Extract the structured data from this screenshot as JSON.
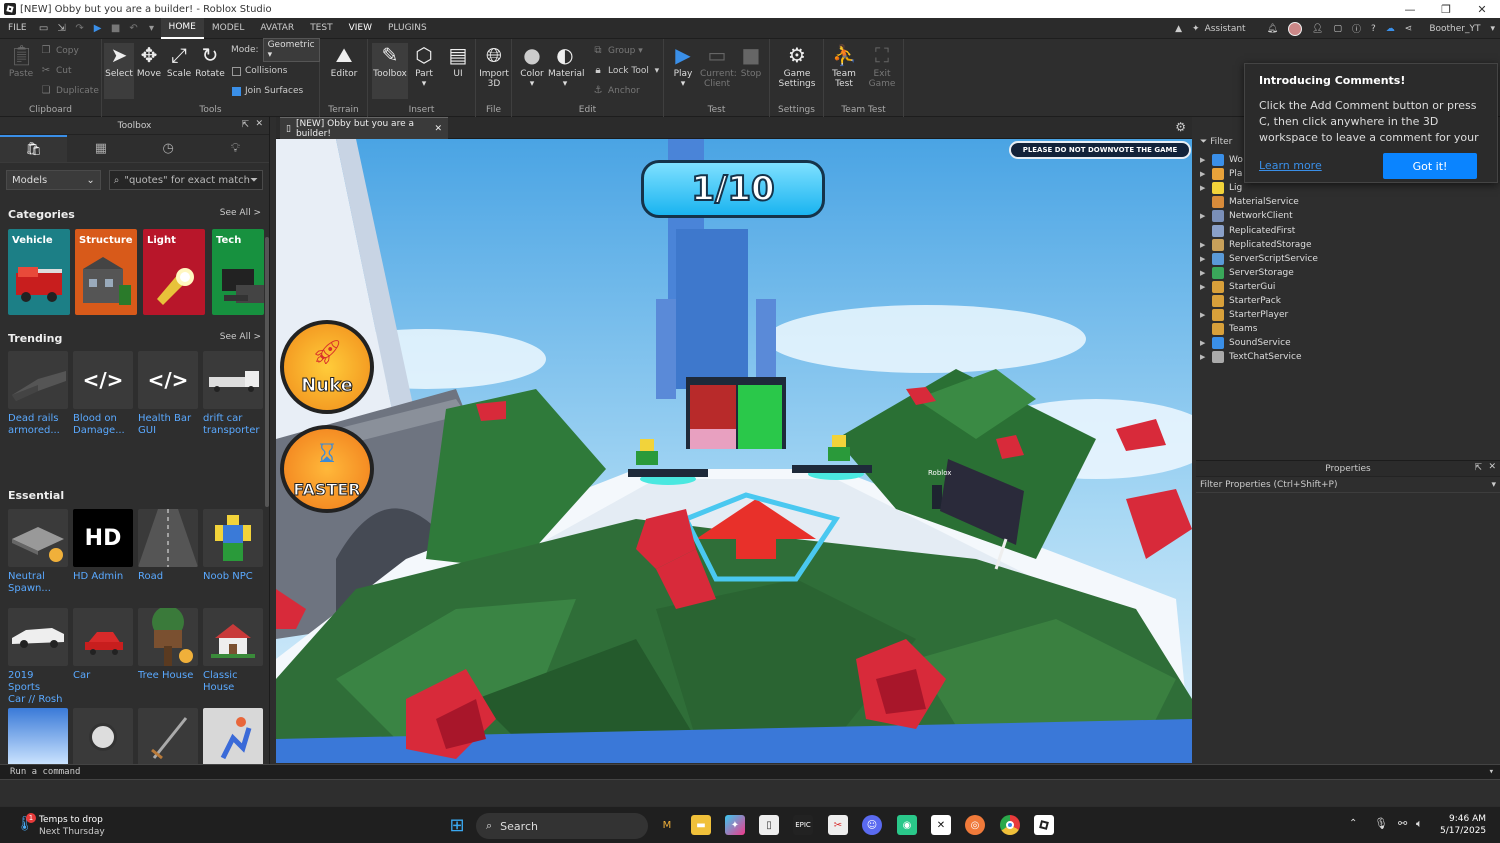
{
  "window": {
    "title": "[NEW] Obby but you are a builder! - Roblox Studio"
  },
  "menubar": {
    "items": [
      "FILE",
      "HOME",
      "MODEL",
      "AVATAR",
      "TEST",
      "VIEW",
      "PLUGINS"
    ],
    "active": "HOME",
    "assistant": "Assistant",
    "username": "Boother_YT"
  },
  "ribbon": {
    "clipboard": {
      "paste": "Paste",
      "copy": "Copy",
      "cut": "Cut",
      "duplicate": "Duplicate",
      "label": "Clipboard"
    },
    "tools": {
      "select": "Select",
      "move": "Move",
      "scale": "Scale",
      "rotate": "Rotate",
      "mode_label": "Mode:",
      "mode_value": "Geometric",
      "collisions": "Collisions",
      "join_surfaces": "Join Surfaces",
      "label": "Tools"
    },
    "terrain": {
      "editor": "Editor",
      "label": "Terrain"
    },
    "insert": {
      "toolbox": "Toolbox",
      "part": "Part",
      "ui": "UI",
      "label": "Insert"
    },
    "file": {
      "import1": "Import",
      "import2": "3D",
      "label": "File"
    },
    "edit": {
      "color": "Color",
      "material": "Material",
      "group": "Group",
      "lock_tool": "Lock Tool",
      "anchor": "Anchor",
      "label": "Edit"
    },
    "test": {
      "play": "Play",
      "current1": "Current:",
      "current2": "Client",
      "stop": "Stop",
      "label": "Test"
    },
    "settings": {
      "game1": "Game",
      "game2": "Settings",
      "label": "Settings"
    },
    "teamtest": {
      "team1": "Team",
      "team2": "Test",
      "exit1": "Exit",
      "exit2": "Game",
      "label": "Team Test"
    }
  },
  "toolbox": {
    "title": "Toolbox",
    "category_select": "Models",
    "search_placeholder": "\"quotes\" for exact match",
    "categories_title": "Categories",
    "trending_title": "Trending",
    "essential_title": "Essential",
    "see_all": "See All >",
    "categories": [
      {
        "name": "Vehicle",
        "color": "#1c7f86"
      },
      {
        "name": "Structure",
        "color": "#d85a1a"
      },
      {
        "name": "Light",
        "color": "#b8162a"
      },
      {
        "name": "Tech",
        "color": "#17913f"
      }
    ],
    "trending": [
      {
        "l1": "Dead rails",
        "l2": "armored..."
      },
      {
        "l1": "Blood on",
        "l2": "Damage..."
      },
      {
        "l1": "Health Bar",
        "l2": "GUI"
      },
      {
        "l1": "drift car",
        "l2": "transporter"
      }
    ],
    "essential_row1": [
      {
        "l1": "Neutral",
        "l2": "Spawn..."
      },
      {
        "l1": "HD Admin",
        "l2": ""
      },
      {
        "l1": "Road",
        "l2": ""
      },
      {
        "l1": "Noob NPC",
        "l2": ""
      }
    ],
    "essential_row2": [
      {
        "l1": "2019 Sports",
        "l2": "Car // Rosh"
      },
      {
        "l1": "Car",
        "l2": ""
      },
      {
        "l1": "Tree House",
        "l2": ""
      },
      {
        "l1": "Classic",
        "l2": "House"
      }
    ],
    "hd_text": "HD"
  },
  "document": {
    "tab": "[NEW] Obby but you are a builder!"
  },
  "viewport": {
    "progress": "1/10",
    "banner": "PLEASE DO NOT DOWNVOTE THE GAME",
    "nuke": "Nuke",
    "faster": "FASTER",
    "roblox_label": "Roblox"
  },
  "explorer": {
    "filter": "Filter",
    "items": [
      {
        "name": "Wo",
        "icon": "#3a8fe8",
        "arrow": true
      },
      {
        "name": "Pla",
        "icon": "#e8a23a",
        "arrow": true
      },
      {
        "name": "Lig",
        "icon": "#f2d33a",
        "arrow": true
      },
      {
        "name": "MaterialService",
        "icon": "#d88b3a",
        "arrow": false
      },
      {
        "name": "NetworkClient",
        "icon": "#7a8fb8",
        "arrow": true
      },
      {
        "name": "ReplicatedFirst",
        "icon": "#8aa0c8",
        "arrow": false
      },
      {
        "name": "ReplicatedStorage",
        "icon": "#c8a05a",
        "arrow": true
      },
      {
        "name": "ServerScriptService",
        "icon": "#5a9ad8",
        "arrow": true
      },
      {
        "name": "ServerStorage",
        "icon": "#3aa85a",
        "arrow": true
      },
      {
        "name": "StarterGui",
        "icon": "#d8a03a",
        "arrow": true
      },
      {
        "name": "StarterPack",
        "icon": "#d8a03a",
        "arrow": false
      },
      {
        "name": "StarterPlayer",
        "icon": "#d8a03a",
        "arrow": true
      },
      {
        "name": "Teams",
        "icon": "#d8a03a",
        "arrow": false
      },
      {
        "name": "SoundService",
        "icon": "#3a8fe8",
        "arrow": true
      },
      {
        "name": "TextChatService",
        "icon": "#aaaaaa",
        "arrow": true
      }
    ]
  },
  "popup": {
    "title": "Introducing Comments!",
    "body": "Click the Add Comment button or press C, then click anywhere in the 3D workspace to leave a comment for your",
    "learn_more": "Learn more",
    "got_it": "Got it!"
  },
  "properties": {
    "title": "Properties",
    "filter": "Filter Properties (Ctrl+Shift+P)"
  },
  "command": {
    "placeholder": "Run a command"
  },
  "taskbar": {
    "weather_title": "Temps to drop",
    "weather_sub": "Next Thursday",
    "weather_badge": "1",
    "search": "Search",
    "time": "9:46 AM",
    "date": "5/17/2025"
  }
}
